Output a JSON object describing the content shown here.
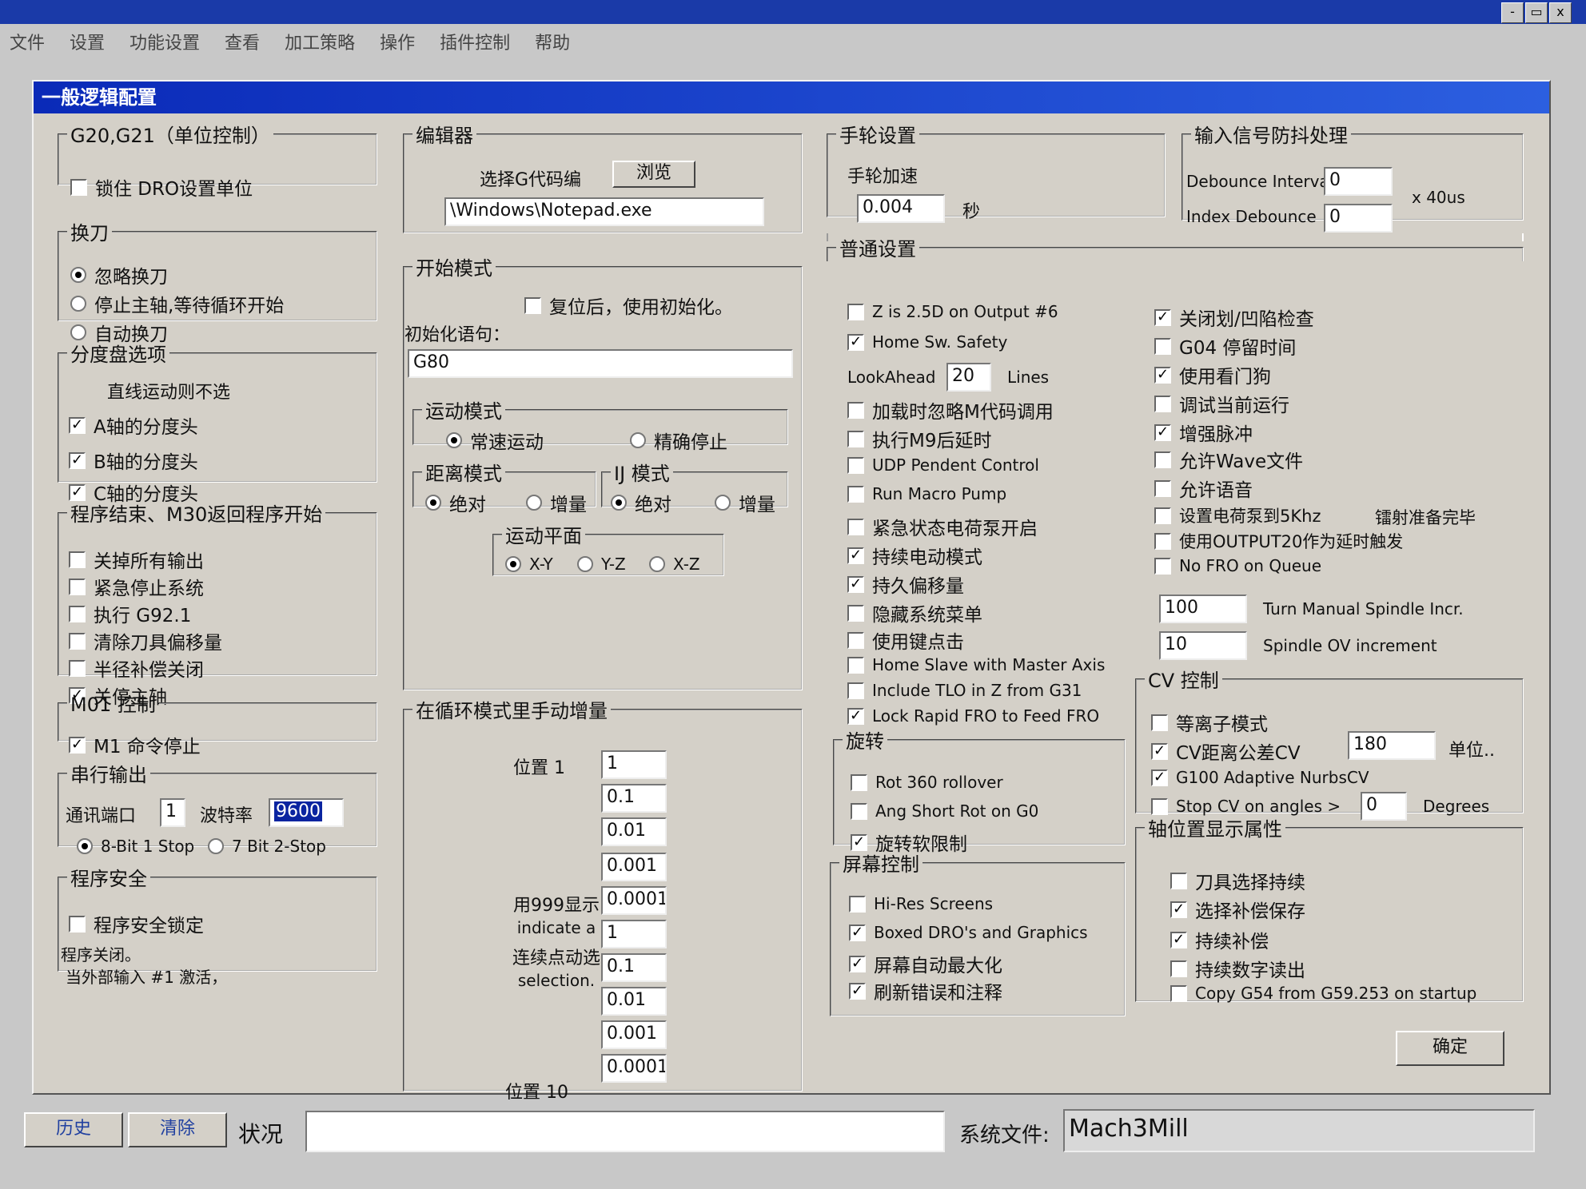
{
  "app": {
    "menu": [
      "文件",
      "设置",
      "功能设置",
      "查看",
      "加工策略",
      "操作",
      "插件控制",
      "帮助"
    ],
    "window_buttons": [
      "-",
      "▭",
      "x"
    ]
  },
  "dialog": {
    "title": "一般逻辑配置",
    "g20": {
      "title": "G20,G21（单位控制）",
      "lock_dro": "锁住 DRO设置单位",
      "lock_dro_checked": false
    },
    "toolchange": {
      "title": "换刀",
      "options": [
        "忽略换刀",
        "停止主轴,等待循环开始",
        "自动换刀"
      ],
      "selected": 0
    },
    "indexer": {
      "title": "分度盘选项",
      "note": "直线运动则不选",
      "a": "A轴的分度头",
      "b": "B轴的分度头",
      "c": "C轴的分度头",
      "a_checked": true,
      "b_checked": true,
      "c_checked": true
    },
    "program_end": {
      "title": "程序结束、M30返回程序开始",
      "items": [
        {
          "label": "关掉所有输出",
          "checked": false
        },
        {
          "label": "紧急停止系统",
          "checked": false
        },
        {
          "label": "执行 G92.1",
          "checked": false
        },
        {
          "label": "清除刀具偏移量",
          "checked": false
        },
        {
          "label": "半径补偿关闭",
          "checked": false
        },
        {
          "label": "关停主轴",
          "checked": true
        }
      ]
    },
    "m01": {
      "title": "M01 控制",
      "label": "M1 命令停止",
      "checked": true
    },
    "serial": {
      "title": "串行输出",
      "port_label": "通讯端口",
      "port": "1",
      "baud_label": "波特率",
      "baud": "9600",
      "opt1": "8-Bit 1 Stop",
      "opt2": "7 Bit 2-Stop",
      "selected": 0
    },
    "security": {
      "title": "程序安全",
      "lock_label": "程序安全锁定",
      "lock_checked": false,
      "note1": "程序关闭。",
      "note2": "当外部输入 #1 激活，"
    },
    "editor": {
      "title": "编辑器",
      "select_label": "选择G代码编",
      "browse": "浏览",
      "path": "\\Windows\\Notepad.exe"
    },
    "startup": {
      "title": "开始模式",
      "reset_init": "复位后，使用初始化。",
      "reset_init_checked": false,
      "init_label": "初始化语句：",
      "init_value": "G80",
      "motion_title": "运动模式",
      "motion_opts": [
        "常速运动",
        "精确停止"
      ],
      "motion_sel": 0,
      "dist_title": "距离模式",
      "dist_opts": [
        "绝对",
        "增量"
      ],
      "dist_sel": 0,
      "ij_title": "IJ 模式",
      "ij_opts": [
        "绝对",
        "增量"
      ],
      "ij_sel": 0,
      "plane_title": "运动平面",
      "plane_opts": [
        "X-Y",
        "Y-Z",
        "X-Z"
      ],
      "plane_sel": 0
    },
    "jog": {
      "title": "在循环模式里手动增量",
      "pos1": "位置 1",
      "pos10": "位置 10",
      "note": [
        "用999显示",
        "indicate a",
        "连续点动选",
        "selection."
      ],
      "values": [
        "1",
        "0.1",
        "0.01",
        "0.001",
        "0.0001",
        "1",
        "0.1",
        "0.01",
        "0.001",
        "0.0001"
      ]
    },
    "mpg": {
      "title": "手轮设置",
      "accel_label": "手轮加速",
      "accel": "0.004",
      "unit": "秒"
    },
    "debounce": {
      "title": "输入信号防抖处理",
      "interval_label": "Debounce Interval",
      "interval": "0",
      "index_label": "Index Debounce",
      "index": "0",
      "unit": "x 40us"
    },
    "general": {
      "title": "普通设置",
      "left": [
        {
          "label": "Z is 2.5D on Output #6",
          "checked": false
        },
        {
          "label": "Home Sw. Safety",
          "checked": true
        }
      ],
      "lookahead_label": "LookAhead",
      "lookahead": "20",
      "lookahead_unit": "Lines",
      "left2": [
        {
          "label": "加载时忽略M代码调用",
          "checked": false
        },
        {
          "label": "执行M9后延时",
          "checked": false
        },
        {
          "label": "UDP Pendent Control",
          "checked": false
        },
        {
          "label": "Run Macro Pump",
          "checked": false
        },
        {
          "label": "紧急状态电荷泵开启",
          "checked": false
        },
        {
          "label": "持续电动模式",
          "checked": true
        },
        {
          "label": "持久偏移量",
          "checked": true
        },
        {
          "label": "隐藏系统菜单",
          "checked": false
        },
        {
          "label": "使用键点击",
          "checked": false
        },
        {
          "label": "Home Slave with Master Axis",
          "checked": false
        },
        {
          "label": "Include TLO in Z from G31",
          "checked": false
        },
        {
          "label": "Lock Rapid FRO to Feed FRO",
          "checked": true
        }
      ],
      "right": [
        {
          "label": "关闭划/凹陷检查",
          "checked": true
        },
        {
          "label": "G04 停留时间",
          "checked": false
        },
        {
          "label": "使用看门狗",
          "checked": true
        },
        {
          "label": "调试当前运行",
          "checked": false
        },
        {
          "label": "增强脉冲",
          "checked": true
        },
        {
          "label": "允许Wave文件",
          "checked": false
        },
        {
          "label": "允许语音",
          "checked": false
        },
        {
          "label": "设置电荷泵到5Khz",
          "checked": false
        },
        {
          "label": "使用OUTPUT20作为延时触发",
          "checked": false
        },
        {
          "label": "No FRO on Queue",
          "checked": false
        }
      ],
      "laser_note": "镭射准备完毕",
      "spindle_incr": "100",
      "spindle_incr_label": "Turn Manual Spindle Incr.",
      "spindle_ov": "10",
      "spindle_ov_label": "Spindle OV increment"
    },
    "rotation": {
      "title": "旋转",
      "items": [
        {
          "label": "Rot 360 rollover",
          "checked": false
        },
        {
          "label": "Ang Short Rot on G0",
          "checked": false
        },
        {
          "label": "旋转软限制",
          "checked": true
        }
      ]
    },
    "cv": {
      "title": "CV 控制",
      "plasma": "等离子模式",
      "plasma_checked": false,
      "dist_label": "CV距离公差CV",
      "dist_checked": true,
      "dist": "180",
      "dist_unit": "单位..",
      "g100": "G100 Adaptive NurbsCV",
      "g100_checked": true,
      "stop_label": "Stop CV on angles >",
      "stop_checked": false,
      "stop": "0",
      "stop_unit": "Degrees"
    },
    "screen": {
      "title": "屏幕控制",
      "items": [
        {
          "label": "Hi-Res Screens",
          "checked": false
        },
        {
          "label": "Boxed DRO's and Graphics",
          "checked": true
        },
        {
          "label": "屏幕自动最大化",
          "checked": true
        },
        {
          "label": "刷新错误和注释",
          "checked": true
        }
      ]
    },
    "axis_display": {
      "title": "轴位置显示属性",
      "items": [
        {
          "label": "刀具选择持续",
          "checked": false
        },
        {
          "label": "选择补偿保存",
          "checked": true
        },
        {
          "label": "持续补偿",
          "checked": true
        },
        {
          "label": "持续数字读出",
          "checked": false
        },
        {
          "label": "Copy G54 from G59.253 on startup",
          "checked": false
        }
      ]
    },
    "ok": "确定"
  },
  "status": {
    "history": "历史",
    "clear": "清除",
    "status_label": "状况",
    "status_text": "",
    "sysfile_label": "系统文件:",
    "sysfile": "Mach3Mill"
  }
}
